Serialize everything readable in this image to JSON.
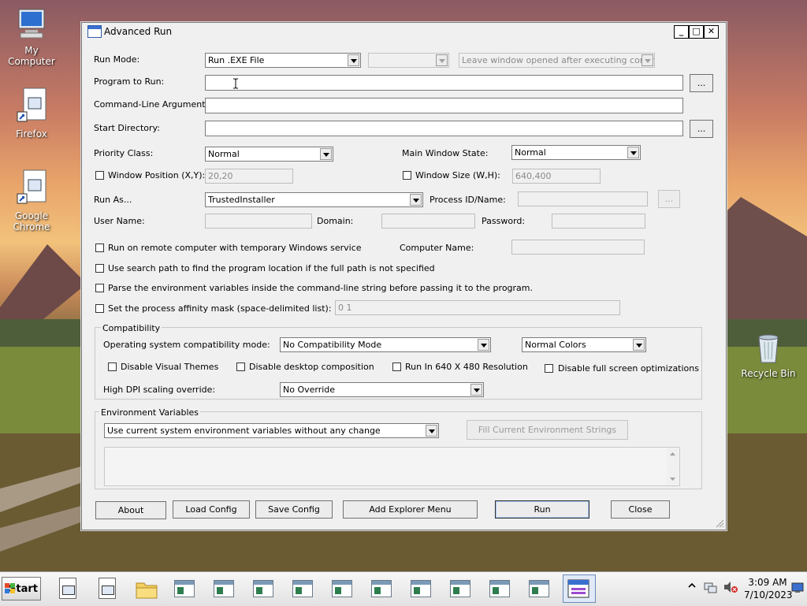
{
  "desktop": {
    "icons": [
      {
        "label": "My Computer"
      },
      {
        "label": "Firefox"
      },
      {
        "label": "Google Chrome"
      },
      {
        "label": "Recycle Bin"
      }
    ]
  },
  "window": {
    "title": "Advanced Run",
    "controls": {
      "minimize": "_",
      "maximize": "□",
      "close": "✕"
    }
  },
  "form": {
    "run_mode": {
      "label": "Run Mode:",
      "value": "Run .EXE File",
      "second_value": "",
      "third_value": "Leave window opened after executing command"
    },
    "program": {
      "label": "Program to Run:",
      "value": "",
      "browse": "..."
    },
    "args": {
      "label": "Command-Line Arguments:",
      "value": ""
    },
    "start_dir": {
      "label": "Start Directory:",
      "value": "",
      "browse": "..."
    },
    "priority": {
      "label": "Priority Class:",
      "value": "Normal"
    },
    "main_window_state": {
      "label": "Main Window State:",
      "value": "Normal"
    },
    "window_position": {
      "label": "Window Position (X,Y):",
      "value": "20,20"
    },
    "window_size": {
      "label": "Window Size (W,H):",
      "value": "640,400"
    },
    "run_as": {
      "label": "Run As...",
      "value": "TrustedInstaller"
    },
    "process_id": {
      "label": "Process ID/Name:",
      "value": "",
      "browse": "..."
    },
    "user_name": {
      "label": "User Name:",
      "value": ""
    },
    "domain": {
      "label": "Domain:",
      "value": ""
    },
    "password": {
      "label": "Password:",
      "value": ""
    },
    "remote": {
      "label": "Run on remote computer with temporary Windows service"
    },
    "computer_name": {
      "label": "Computer Name:",
      "value": ""
    },
    "search_path": {
      "label": "Use search path to find the program location if the full path is not specified"
    },
    "parse_env": {
      "label": "Parse the environment variables inside the command-line string before passing it to the program."
    },
    "affinity": {
      "label": "Set the process affinity mask (space-delimited list):",
      "value": "0 1"
    }
  },
  "compatibility": {
    "title": "Compatibility",
    "os_mode_label": "Operating system compatibility mode:",
    "os_mode_value": "No Compatibility Mode",
    "colors_value": "Normal Colors",
    "disable_themes": "Disable Visual Themes",
    "disable_composition": "Disable desktop composition",
    "run_640": "Run In 640 X 480 Resolution",
    "disable_fullscreen": "Disable full screen optimizations",
    "dpi_label": "High DPI scaling override:",
    "dpi_value": "No Override"
  },
  "environment": {
    "title": "Environment Variables",
    "mode_value": "Use current system environment variables without any change",
    "fill_button": "Fill Current Environment Strings",
    "text": ""
  },
  "buttons": {
    "about": "About",
    "load_config": "Load Config",
    "save_config": "Save Config",
    "add_explorer_menu": "Add Explorer Menu",
    "run": "Run",
    "close": "Close"
  },
  "taskbar": {
    "start_label": "Start",
    "time": "3:09 AM",
    "date": "7/10/2023"
  }
}
